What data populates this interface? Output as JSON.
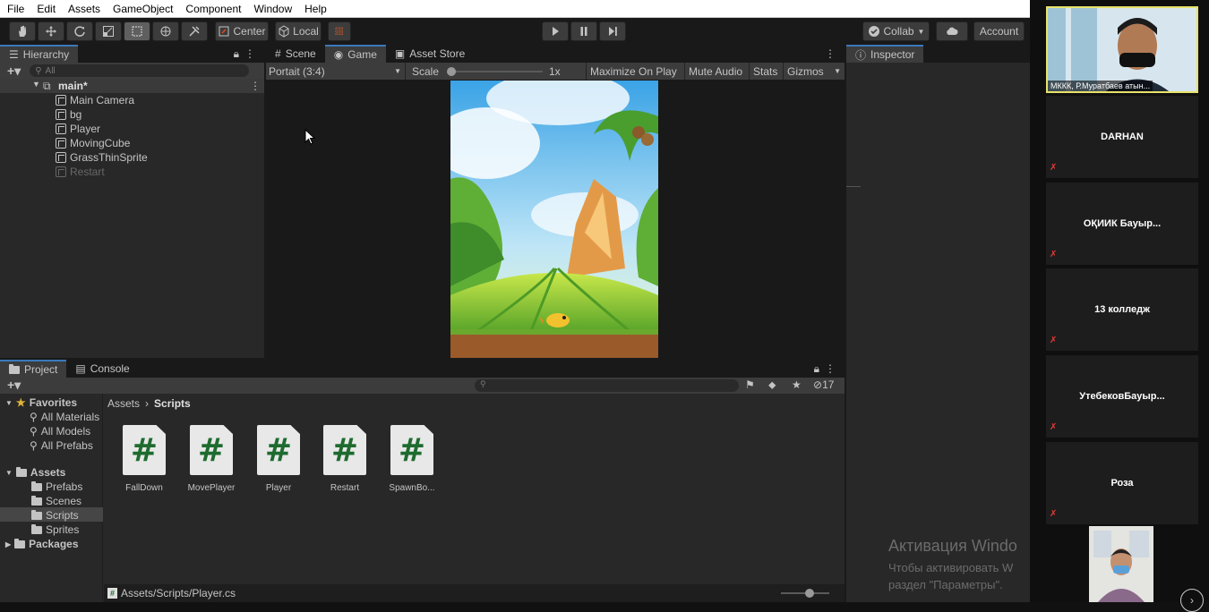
{
  "menu": [
    "File",
    "Edit",
    "Assets",
    "GameObject",
    "Component",
    "Window",
    "Help"
  ],
  "toolbar": {
    "center_label": "Center",
    "local_label": "Local",
    "collab_label": "Collab",
    "account_label": "Account"
  },
  "hierarchy": {
    "tab": "Hierarchy",
    "search_placeholder": "All",
    "scene_name": "main*",
    "objects": [
      "Main Camera",
      "bg",
      "Player",
      "MovingCube",
      "GrassThinSprite",
      "Restart"
    ]
  },
  "center_tabs": [
    "Scene",
    "Game",
    "Asset Store"
  ],
  "game_bar": {
    "aspect": "Portait (3:4)",
    "scale_label": "Scale",
    "scale_value": "1x",
    "maximize": "Maximize On Play",
    "mute": "Mute Audio",
    "stats": "Stats",
    "gizmos": "Gizmos"
  },
  "inspector": {
    "tab": "Inspector"
  },
  "project": {
    "tabs": [
      "Project",
      "Console"
    ],
    "hidden_count": "17",
    "favorites": {
      "label": "Favorites",
      "items": [
        "All Materials",
        "All Models",
        "All Prefabs"
      ]
    },
    "assets": {
      "label": "Assets",
      "items": [
        "Prefabs",
        "Scenes",
        "Scripts",
        "Sprites"
      ]
    },
    "packages": "Packages",
    "breadcrumb": [
      "Assets",
      "Scripts"
    ],
    "scripts": [
      "FallDown",
      "MovePlayer",
      "Player",
      "Restart",
      "SpawnBo..."
    ],
    "script_glyph": "#",
    "footer_path": "Assets/Scripts/Player.cs"
  },
  "watermark": {
    "title": "Активация Windo",
    "line1": "Чтобы активировать W",
    "line2": "раздел \"Параметры\"."
  },
  "participants": {
    "top_caption": "МККК, Р.Муратбаев атын...",
    "names": [
      "DARHAN",
      "ОҚИИК Бауыр...",
      "13 колледж",
      "УтебековБауыр...",
      "Роза"
    ]
  },
  "colors": {
    "accent": "#3a79bb",
    "script_hash": "#1e6b2f",
    "muted_mic": "#e53935"
  }
}
